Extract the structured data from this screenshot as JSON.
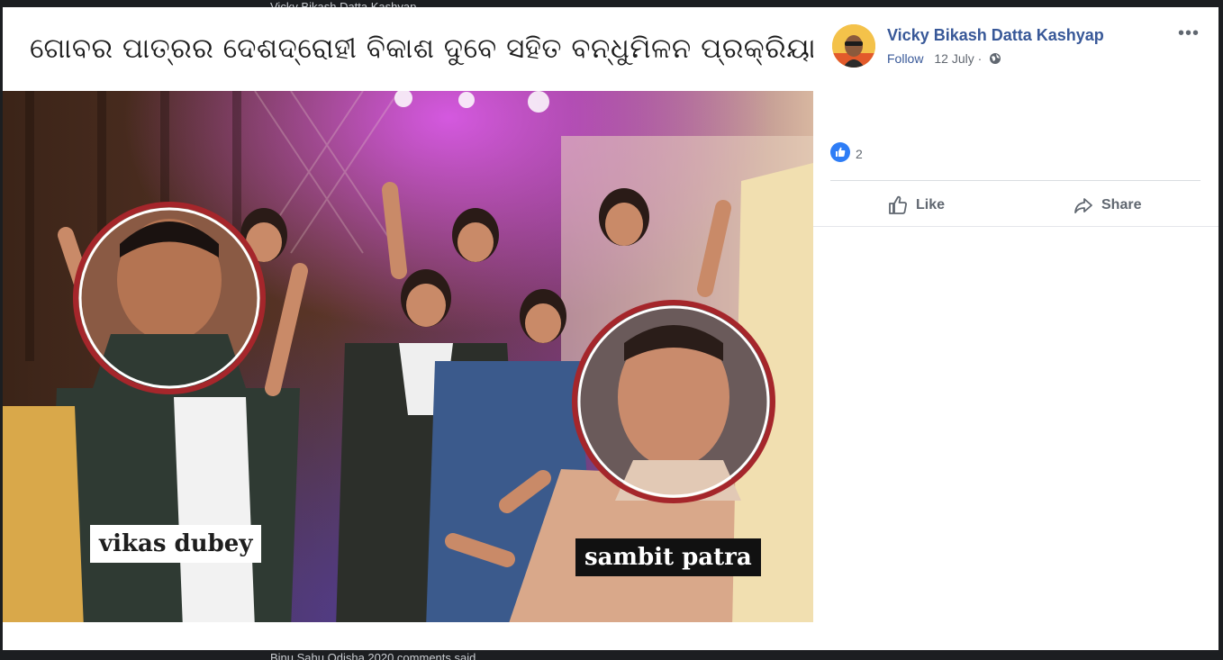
{
  "ghost": {
    "top_text": "Vicky Bikash Datta Kashyap",
    "bottom_text": "Binu Sahu Odisha 2020 comments said"
  },
  "post": {
    "caption": "ଗୋବର ପାତ୍ରର ଦେଶଦ୍ରୋହୀ ବିକାଶ ଦୁବେ ସହିତ ବନ୍ଧୁମିଳନ ପ୍ରକ୍ରିୟା...",
    "labels": {
      "left": "vikas dubey",
      "right": "sambit patra"
    },
    "circle_color": "#a5262b"
  },
  "author": {
    "name": "Vicky Bikash Datta Kashyap",
    "follow": "Follow",
    "separator": "·",
    "date": "12 July",
    "privacy_icon": "globe-icon"
  },
  "menu": {
    "more": "•••",
    "icon": "more-options-icon"
  },
  "reactions": {
    "count": "2",
    "icon": "like-reaction-icon"
  },
  "actions": {
    "like": "Like",
    "share": "Share"
  },
  "colors": {
    "link": "#385898",
    "reaction_blue": "#2e7df6",
    "muted": "#606770"
  }
}
